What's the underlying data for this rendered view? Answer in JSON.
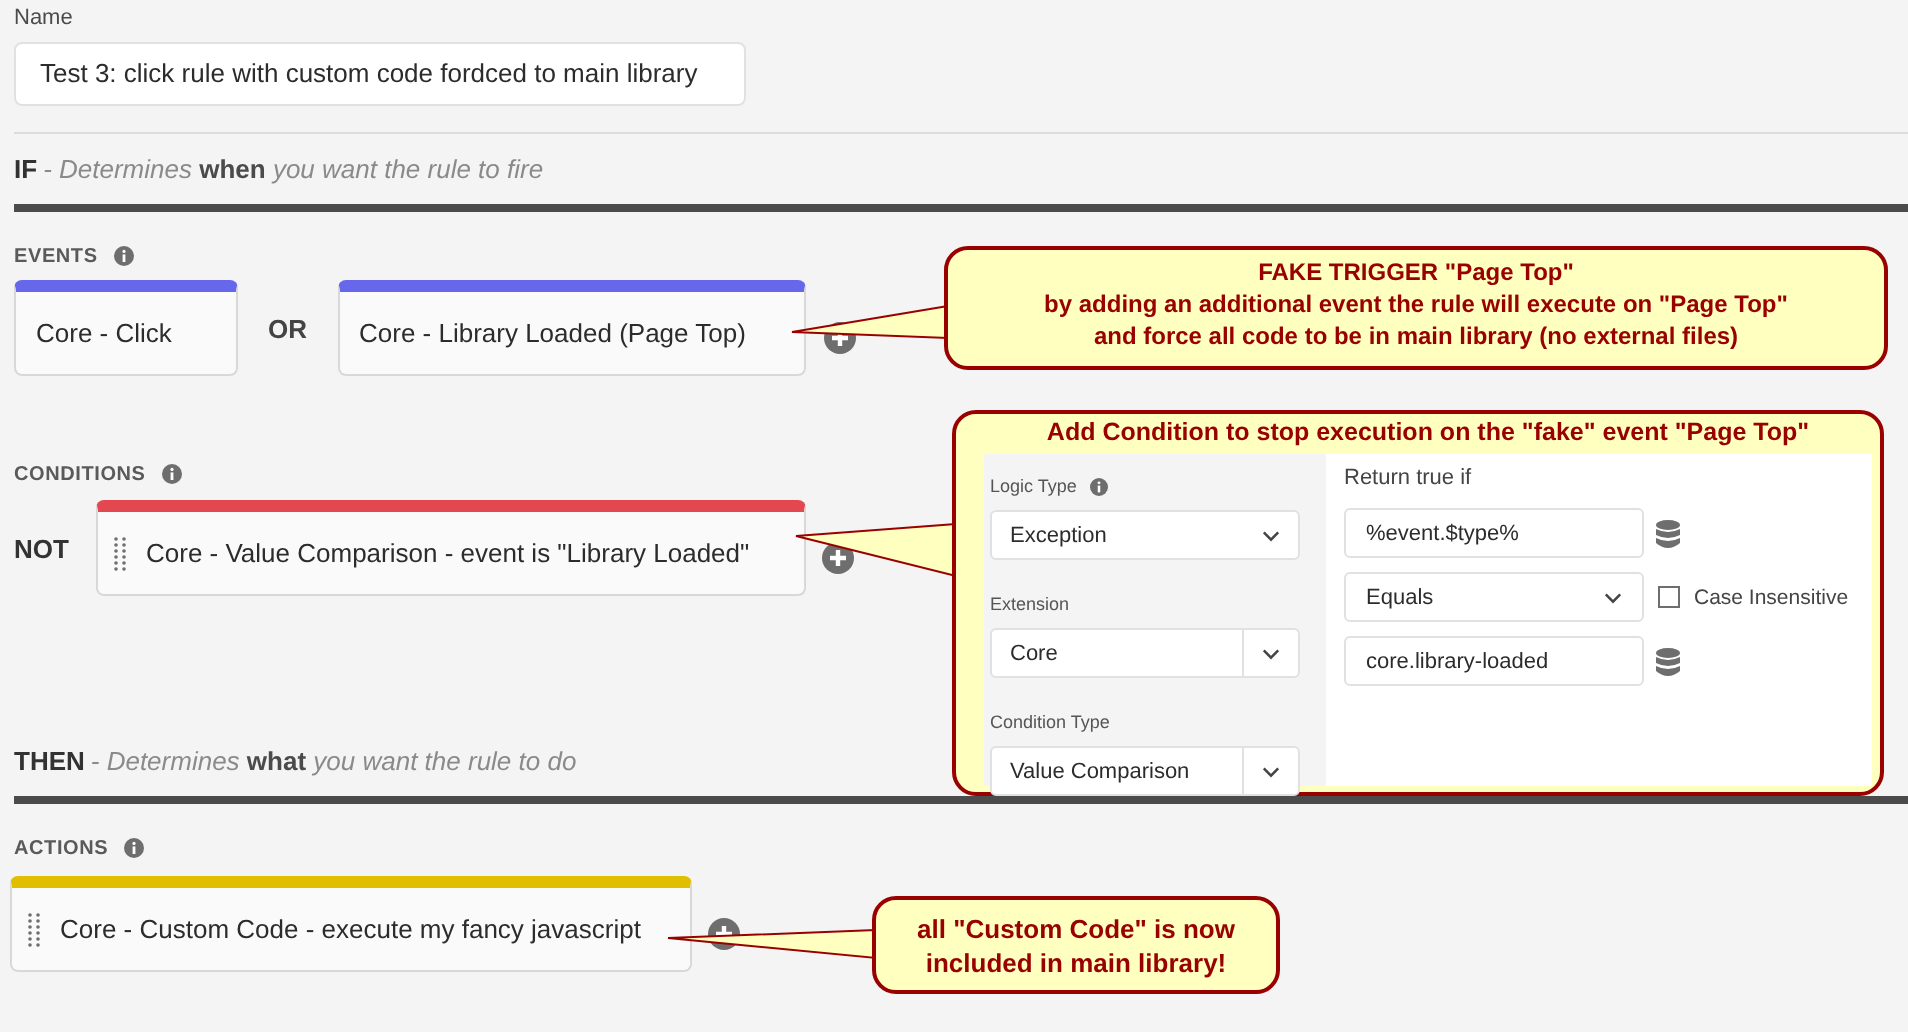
{
  "name_field": {
    "label": "Name",
    "value": "Test 3: click rule with custom code fordced to main library"
  },
  "if_section": {
    "keyword": "IF",
    "description": "- Determines **when** you want the rule to fire"
  },
  "events": {
    "heading": "EVENTS",
    "joiner": "OR",
    "items": [
      {
        "label": "Core - Click"
      },
      {
        "label": "Core - Library Loaded (Page Top)"
      }
    ]
  },
  "conditions": {
    "heading": "CONDITIONS",
    "operator": "NOT",
    "items": [
      {
        "label": "Core - Value Comparison - event is \"Library Loaded\""
      }
    ]
  },
  "then_section": {
    "keyword": "THEN",
    "description": "- Determines **what** you want the rule to do"
  },
  "actions": {
    "heading": "ACTIONS",
    "items": [
      {
        "label": "Core - Custom Code - execute my fancy javascript"
      }
    ]
  },
  "callouts": [
    {
      "kind": "text",
      "lines": [
        "FAKE TRIGGER \"Page Top\"",
        "by adding an additional event the rule will execute on \"Page Top\"",
        "and force all code to be in main library (no external files)"
      ]
    },
    {
      "kind": "panel",
      "title": "Add Condition to stop execution on the \"fake\" event \"Page Top\"",
      "panel": {
        "logic_type": {
          "label": "Logic Type",
          "value": "Exception"
        },
        "extension": {
          "label": "Extension",
          "value": "Core"
        },
        "condition_type": {
          "label": "Condition Type",
          "value": "Value Comparison"
        },
        "return_label": "Return true if",
        "left_operand": "%event.$type%",
        "operator": "Equals",
        "case_insensitive": {
          "label": "Case Insensitive",
          "checked": false
        },
        "right_operand": "core.library-loaded"
      }
    },
    {
      "kind": "text",
      "lines": [
        "all \"Custom Code\" is now",
        "included in main library!"
      ]
    }
  ]
}
